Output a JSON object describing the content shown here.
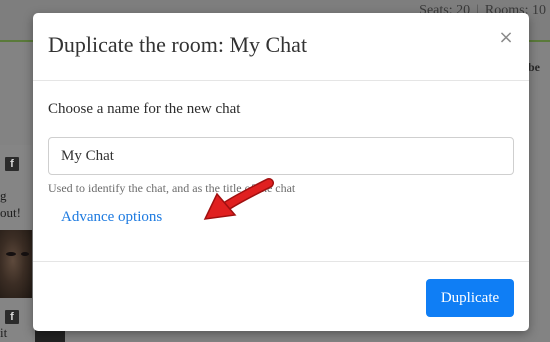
{
  "background": {
    "stats": {
      "seats": "Seats: 20",
      "rooms": "Rooms: 10"
    },
    "right_label": "be",
    "snippets": [
      "g",
      "out!",
      "it"
    ],
    "fb_glyph": "f"
  },
  "modal": {
    "title": "Duplicate the room: My Chat",
    "close_glyph": "×",
    "field_label": "Choose a name for the new chat",
    "name_value": "My Chat",
    "help_text": "Used to identify the chat, and as the title of the chat",
    "advance_options": "Advance options",
    "duplicate_label": "Duplicate"
  },
  "colors": {
    "accent": "#0f7ef5",
    "link": "#1d7ae0",
    "annotation_arrow": "#e02020"
  }
}
